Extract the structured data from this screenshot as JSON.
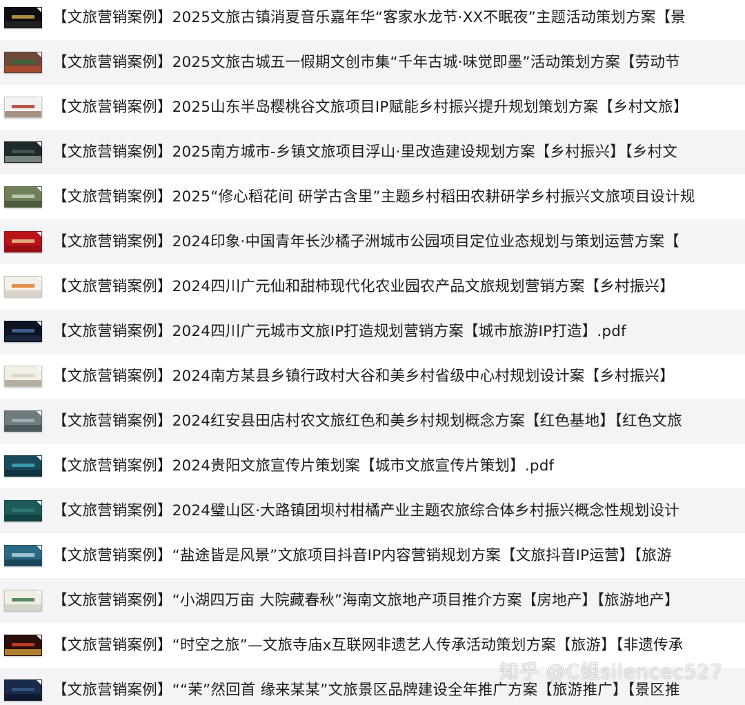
{
  "files": [
    {
      "name": "【文旅营销案例】2025文旅古镇消夏音乐嘉年华“客家水龙节·XX不眠夜”主题活动策划方案【景",
      "thumb": {
        "bg": "#0e0f12",
        "accent": "#c9a24a",
        "accent2": "#2a2a2a"
      }
    },
    {
      "name": "【文旅营销案例】2025文旅古城五一假期文创市集“千年古城·味觉即墨”活动策划方案【劳动节",
      "thumb": {
        "bg": "#6d4a3a",
        "accent": "#2f6f3a",
        "accent2": "#c04a2c"
      }
    },
    {
      "name": "【文旅营销案例】2025山东半岛樱桃谷文旅项目IP赋能乡村振兴提升规划策划方案【乡村文旅】",
      "thumb": {
        "bg": "#f2f2f2",
        "accent": "#b23a2a",
        "accent2": "#8a6a52"
      }
    },
    {
      "name": "【文旅营销案例】2025南方城市-乡镇文旅项目浮山·里改造建设规划方案【乡村振兴】【乡村文",
      "thumb": {
        "bg": "#1f2a2c",
        "accent": "#4a5d5a",
        "accent2": "#9aa8a0"
      }
    },
    {
      "name": "【文旅营销案例】2025“修心稻花间 研学古含里”主题乡村稻田农耕研学乡村振兴文旅项目设计规",
      "thumb": {
        "bg": "#6f7f5a",
        "accent": "#c9d2c0",
        "accent2": "#3d4a32"
      }
    },
    {
      "name": "【文旅营销案例】2024印象·中国青年长沙橘子洲城市公园项目定位业态规划与策划运营方案【",
      "thumb": {
        "bg": "#b8141a",
        "accent": "#e8c48a",
        "accent2": "#8a0c10"
      }
    },
    {
      "name": "【文旅营销案例】2024四川广元仙和甜柿现代化农业园农产品文旅规划营销方案【乡村振兴】",
      "thumb": {
        "bg": "#f4efe8",
        "accent": "#e07a2a",
        "accent2": "#cfc6b8"
      }
    },
    {
      "name": "【文旅营销案例】2024四川广元城市文旅IP打造规划营销方案【城市旅游IP打造】.pdf",
      "thumb": {
        "bg": "#0c1322",
        "accent": "#4a6aa0",
        "accent2": "#1f2d48"
      }
    },
    {
      "name": "【文旅营销案例】2024南方某县乡镇行政村大谷和美乡村省级中心村规划设计案【乡村振兴】",
      "thumb": {
        "bg": "#f1efe6",
        "accent": "#d8d2bf",
        "accent2": "#9a9482"
      }
    },
    {
      "name": "【文旅营销案例】2024红安县田店村农文旅红色和美乡村规划概念方案【红色基地】【红色文旅",
      "thumb": {
        "bg": "#6e7c80",
        "accent": "#a7b4b6",
        "accent2": "#3b4a4c"
      }
    },
    {
      "name": "【文旅营销案例】2024贵阳文旅宣传片策划案【城市文旅宣传片策划】.pdf",
      "thumb": {
        "bg": "#1a4a5a",
        "accent": "#3fa4b8",
        "accent2": "#0c2a34"
      }
    },
    {
      "name": "【文旅营销案例】2024璧山区·大路镇团坝村柑橘产业主题农旅综合体乡村振兴概念性规划设计",
      "thumb": {
        "bg": "#1c5b5a",
        "accent": "#2f7a76",
        "accent2": "#0f3a3a"
      }
    },
    {
      "name": "【文旅营销案例】“盐途皆是风景”文旅项目抖音IP内容营销规划方案【文旅抖音IP运营】【旅游",
      "thumb": {
        "bg": "#2a6a84",
        "accent": "#b7d4de",
        "accent2": "#14384a"
      }
    },
    {
      "name": "【文旅营销案例】“小湖四万亩 大院藏春秋”海南文旅地产项目推介方案【房地产】【旅游地产】",
      "thumb": {
        "bg": "#eef0e6",
        "accent": "#3f7a4a",
        "accent2": "#c8ccbc"
      }
    },
    {
      "name": "【文旅营销案例】“时空之旅”—文旅寺庙x互联网非遗艺人传承活动策划方案【旅游】【非遗传承",
      "thumb": {
        "bg": "#2a0e0a",
        "accent": "#d2402a",
        "accent2": "#e8b040"
      }
    },
    {
      "name": "【文旅营销案例】““茉”然回首 缘来某某”文旅景区品牌建设全年推广方案【旅游推广】【景区推",
      "thumb": {
        "bg": "#1a2a4a",
        "accent": "#3a5a8a",
        "accent2": "#0c1428"
      }
    }
  ],
  "watermark": "知乎 @C姐silencec527"
}
